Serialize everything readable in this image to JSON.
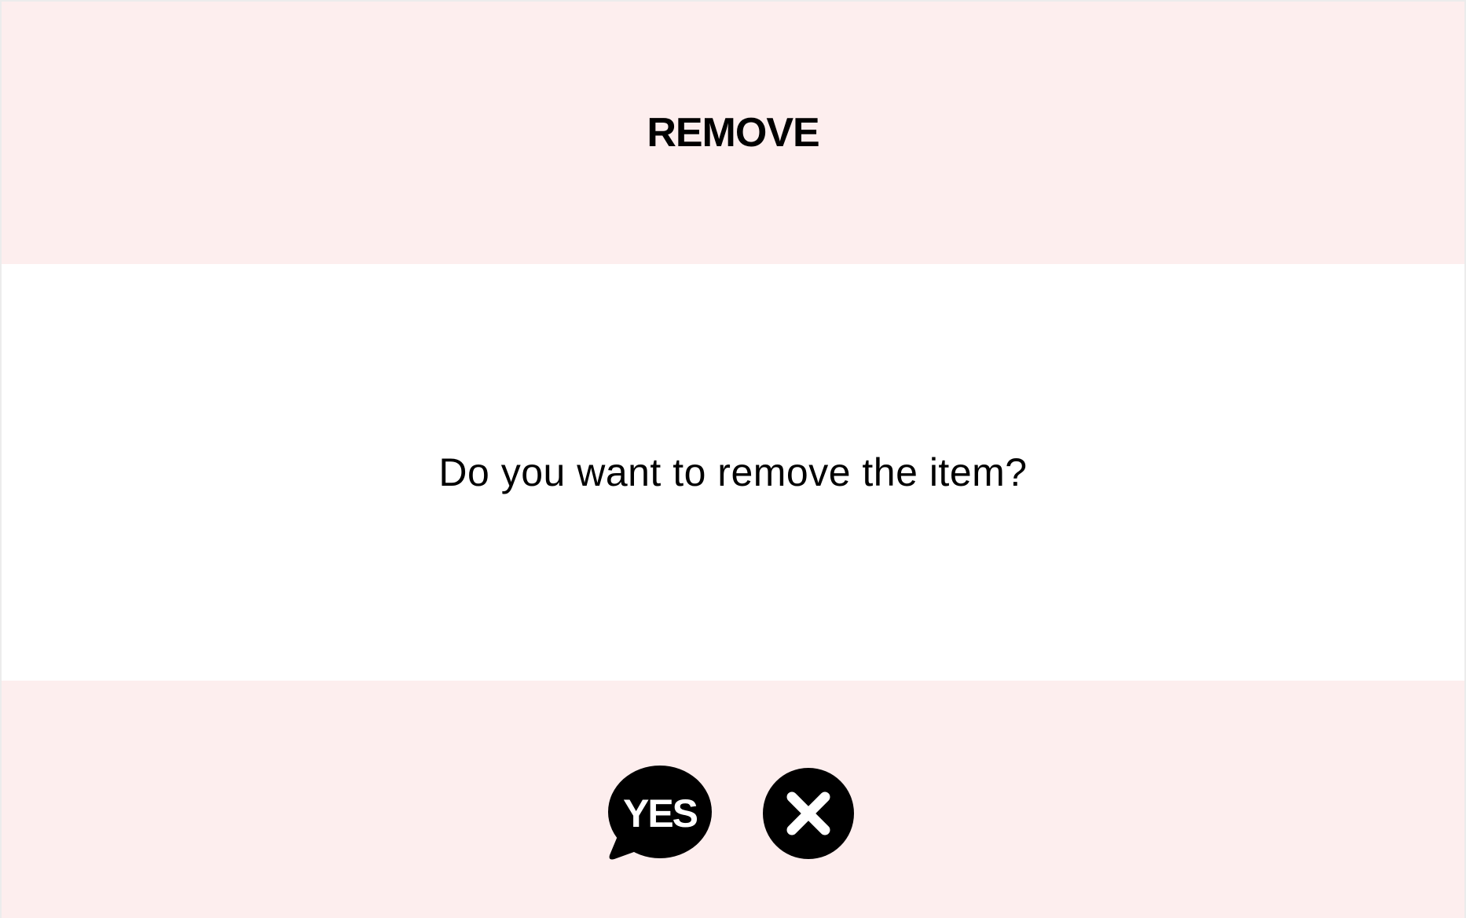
{
  "dialog": {
    "title": "REMOVE",
    "message": "Do you want to remove the item?"
  },
  "actions": {
    "yes": {
      "label": "YES",
      "icon": "yes-speech-bubble-icon"
    },
    "no": {
      "icon": "close-circle-icon"
    }
  },
  "colors": {
    "header_bg": "#fdeeee",
    "body_bg": "#ffffff",
    "footer_bg": "#fdeeee",
    "icon": "#000000",
    "text": "#000000"
  }
}
